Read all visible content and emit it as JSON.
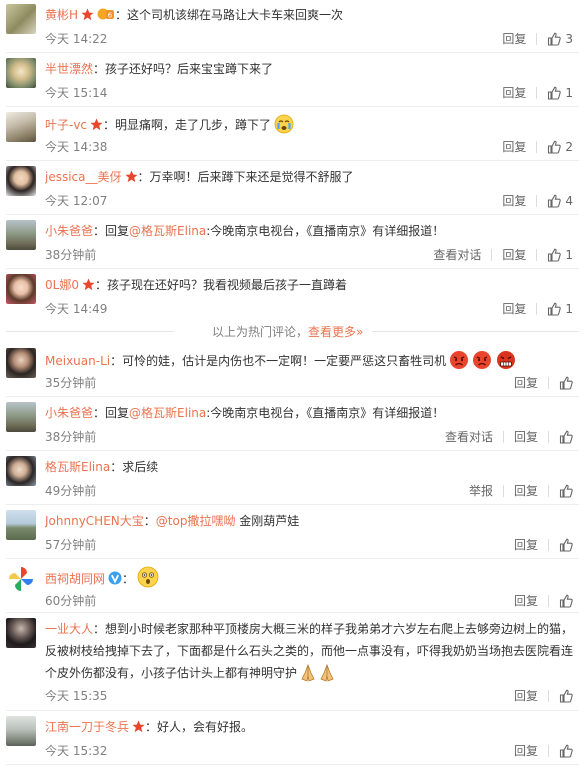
{
  "actions": {
    "reply": "回复",
    "view_conversation": "查看对话",
    "report": "举报"
  },
  "hot_divider": {
    "text": "以上为热门评论，",
    "link": "查看更多»"
  },
  "colors": {
    "username": "#eb7350",
    "mention": "#eb7350",
    "meta": "#808080"
  },
  "comments": [
    {
      "user": "黄彬H",
      "prefix": "：",
      "text": "这个司机该绑在马路让大卡车来回爽一次",
      "time": "今天 14:22",
      "likes": "3"
    },
    {
      "user": "半世漂然",
      "prefix": "：",
      "text": "孩子还好吗？后来宝宝蹲下来了",
      "time": "今天 15:14",
      "likes": "1"
    },
    {
      "user": "叶子-vc",
      "prefix": "：",
      "text": "明显痛啊，走了几步，蹲下了",
      "time": "今天 14:38",
      "likes": "2"
    },
    {
      "user": "jessica__美伢",
      "prefix": "：",
      "text": "万幸啊！后来蹲下来还是觉得不舒服了",
      "time": "今天 12:07",
      "likes": "4"
    },
    {
      "user": "小朱爸爸",
      "prefix": "：回复",
      "mention": "@格瓦斯Elina",
      "text": ":今晚南京电视台，《直播南京》有详细报道！",
      "time": "38分钟前",
      "likes": "1"
    },
    {
      "user": "0L娜0",
      "prefix": "：",
      "text": "孩子现在还好吗？我看视频最后孩子一直蹲着",
      "time": "今天 14:49",
      "likes": "1"
    },
    {
      "user": "Meixuan-Li",
      "prefix": "：",
      "text": "可怜的娃，估计是内伤也不一定啊！一定要严惩这只畜牲司机",
      "time": "35分钟前"
    },
    {
      "user": "小朱爸爸",
      "prefix": "：回复",
      "mention": "@格瓦斯Elina",
      "text": ":今晚南京电视台，《直播南京》有详细报道！",
      "time": "38分钟前"
    },
    {
      "user": "格瓦斯Elina",
      "prefix": "：",
      "text": "求后续",
      "time": "49分钟前"
    },
    {
      "user": "JohnnyCHEN大宝",
      "prefix": "：",
      "mention": "@top撒拉嘿呦",
      "text": " 金刚葫芦娃",
      "time": "57分钟前"
    },
    {
      "user": "西祠胡同网",
      "prefix": "：",
      "text": "",
      "time": "60分钟前"
    },
    {
      "user": "一业大人",
      "prefix": "：",
      "text": "想到小时候老家那种平顶楼房大概三米的样子我弟弟才六岁左右爬上去够旁边树上的猫，反被树枝给拽掉下去了，下面都是什么石头之类的，而他一点事没有，吓得我奶奶当场抱去医院看连个皮外伤都没有，小孩子估计头上都有神明守护",
      "time": "今天 15:35"
    },
    {
      "user": "江南一刀于冬兵",
      "prefix": "：",
      "text": "好人，会有好报。",
      "time": "今天 15:32"
    }
  ]
}
